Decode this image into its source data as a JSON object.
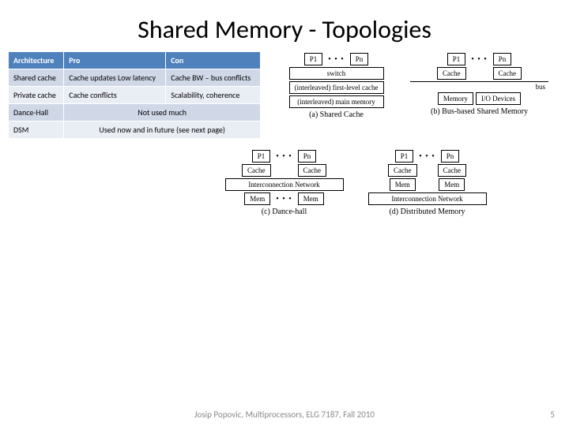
{
  "title": "Shared Memory - Topologies",
  "table": {
    "headers": [
      "Architecture",
      "Pro",
      "Con"
    ],
    "rows": [
      {
        "arch": "Shared cache",
        "pro": "Cache updates Low latency",
        "con": "Cache BW – bus conflicts"
      },
      {
        "arch": "Private cache",
        "pro": "Cache conflicts",
        "con": "Scalability, coherence"
      },
      {
        "arch": "Dance-Hall",
        "merged": "Not used much"
      },
      {
        "arch": "DSM",
        "merged": "Used now and in future (see next page)"
      }
    ]
  },
  "diagrams": {
    "a": {
      "p1": "P1",
      "pn": "Pn",
      "switch": "switch",
      "cache": "(interleaved) first-level cache",
      "mem": "(interleaved) main memory",
      "caption": "(a) Shared Cache"
    },
    "b": {
      "p1": "P1",
      "pn": "Pn",
      "cache": "Cache",
      "bus": "bus",
      "mem": "Memory",
      "io": "I/O Devices",
      "caption": "(b) Bus-based Shared Memory"
    },
    "c": {
      "p1": "P1",
      "pn": "Pn",
      "cache": "Cache",
      "net": "Interconnection Network",
      "mem": "Mem",
      "caption": "(c) Dance-hall"
    },
    "d": {
      "p1": "P1",
      "pn": "Pn",
      "cache": "Cache",
      "mem": "Mem",
      "net": "Interconnection Network",
      "caption": "(d) Distributed Memory"
    }
  },
  "footer": "Josip Popovic, Multiprocessors, ELG 7187, Fall 2010",
  "page": "5"
}
